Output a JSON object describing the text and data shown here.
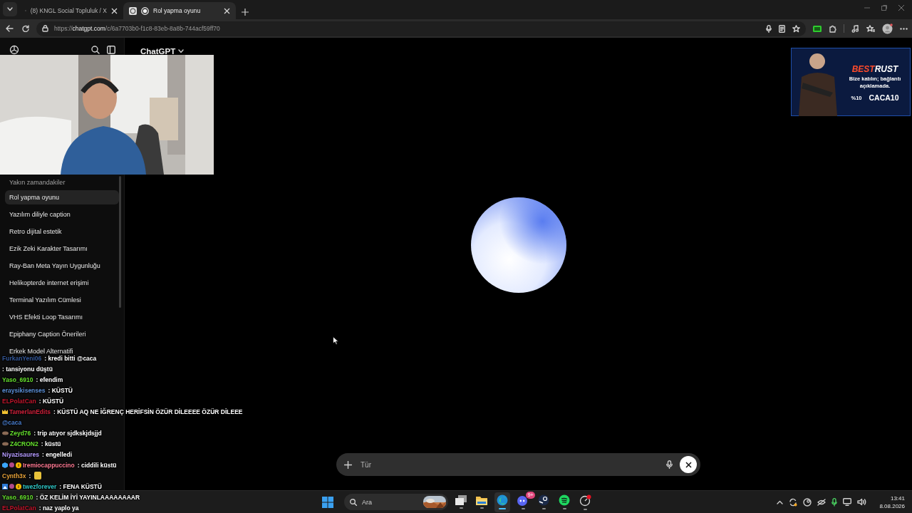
{
  "browser": {
    "tabs": [
      {
        "kind": "x",
        "title": "(8) KNGL Social Topluluk / X",
        "selected": false
      },
      {
        "kind": "chat",
        "title": "Rol yapma oyunu",
        "selected": true
      }
    ],
    "url": {
      "scheme": "https://",
      "host": "chatgpt.com",
      "path": "/c/6a7703b0-f1c8-83eb-8a8b-744acf59ff70"
    }
  },
  "header": {
    "model": "ChatGPT"
  },
  "sidebar": {
    "section_title": "Yakın zamandakiler",
    "items": [
      {
        "label": "Rol yapma oyunu",
        "selected": true
      },
      {
        "label": "Yazılım diliyle caption",
        "selected": false
      },
      {
        "label": "Retro dijital estetik",
        "selected": false
      },
      {
        "label": "Ezik Zeki Karakter Tasarımı",
        "selected": false
      },
      {
        "label": "Ray-Ban Meta Yayın Uygunluğu",
        "selected": false
      },
      {
        "label": "Helikopterde internet erişimi",
        "selected": false
      },
      {
        "label": "Terminal Yazılım Cümlesi",
        "selected": false
      },
      {
        "label": "VHS Efekti Loop Tasarımı",
        "selected": false
      },
      {
        "label": "Epiphany Caption Önerileri",
        "selected": false
      },
      {
        "label": "Erkek Model Alternatifi",
        "selected": false
      }
    ]
  },
  "composer": {
    "placeholder": "Tür"
  },
  "overlay": {
    "ad": {
      "brand_1": "BEST",
      "brand_2": "RUST",
      "tagline": "Bize katılın; bağlantı açıklamada.",
      "discount": "%10",
      "code": "CACA10"
    },
    "chat": [
      {
        "kind": "plain",
        "user": "FurkanYeni06",
        "color": "#34589a",
        "text": ": kredi bitti @caca"
      },
      {
        "kind": "plain",
        "text": ": tansiyonu düştü"
      },
      {
        "kind": "plain",
        "user": "Yaso_6910",
        "color": "#66e22e",
        "text": ": efendim"
      },
      {
        "kind": "plain",
        "user": "eraysikisenses",
        "color": "#5b8fd6",
        "text": ": KÜSTÜ"
      },
      {
        "kind": "plain",
        "user": "ELPolatCan",
        "color": "#c0162c",
        "text": ": KÜSTÜ"
      },
      {
        "kind": "crown",
        "user": "TamerlanEdits",
        "color": "#d0213b",
        "text": ": KÜSTÜ AQ NE İĞRENÇ HERİFSİN ÖZÜR DİLEEEE ÖZÜR DİLEEE"
      },
      {
        "kind": "plain",
        "user": "@caca",
        "color": "#4a7fd0"
      },
      {
        "kind": "mask",
        "user": "Zeyd76",
        "color": "#66e22e",
        "text": ": trip atıyor sjdkskjdsjjd"
      },
      {
        "kind": "mask",
        "user": "Z4CRON2",
        "color": "#66e22e",
        "text": ": küstü"
      },
      {
        "kind": "plain",
        "user": "Niyazisaures",
        "color": "#b59bff",
        "text": ": engelledi"
      },
      {
        "kind": "supporter-cube",
        "user": "Iremiocappuccino",
        "color": "#ff7a93",
        "text": ": ciddili küstü"
      },
      {
        "kind": "emote",
        "user": "Cynth3x",
        "color": "#e8a33a",
        "text": ":"
      },
      {
        "kind": "supporter-image",
        "user": "twezforever",
        "color": "#2ec4c4",
        "text": ": FENA KÜSTÜ"
      },
      {
        "kind": "plain",
        "user": "Yaso_6910",
        "color": "#66e22e",
        "text": ": ÖZ KELİM İYİ YAYINLAAAAAAAAR"
      },
      {
        "kind": "plain",
        "user": "ELPolatCan",
        "color": "#c0162c",
        "text": ": naz yaplo ya"
      }
    ]
  },
  "taskbar": {
    "search_placeholder": "Ara",
    "apps": [
      {
        "kind": "taskview",
        "active": false
      },
      {
        "kind": "explorer",
        "active": false
      },
      {
        "kind": "edge",
        "active": true
      },
      {
        "kind": "discord",
        "active": false,
        "badge": "9+"
      },
      {
        "kind": "steam",
        "active": false
      },
      {
        "kind": "spotify",
        "active": false
      },
      {
        "kind": "alert-app",
        "active": false
      }
    ],
    "time": "13:41",
    "date": "8.08.2026"
  }
}
